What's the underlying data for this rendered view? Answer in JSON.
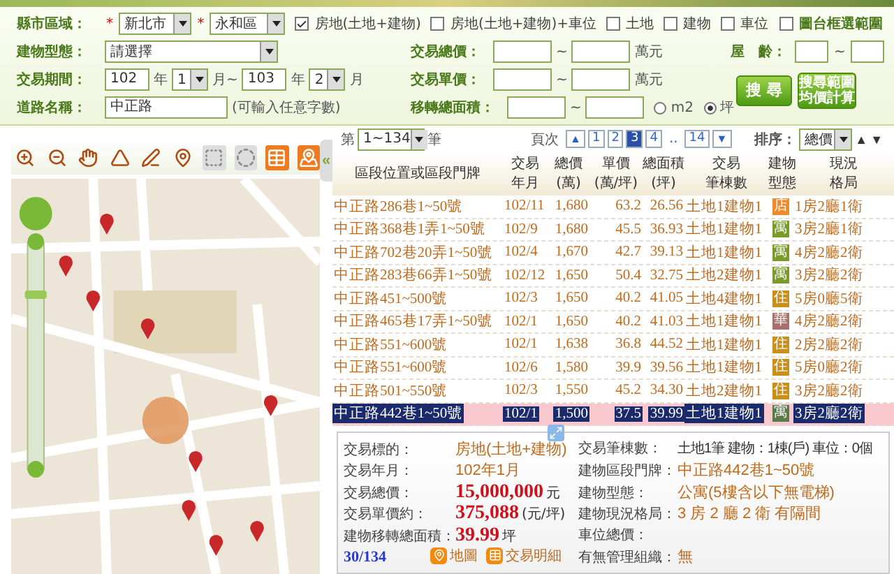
{
  "filters": {
    "region": {
      "label": "縣市區域：",
      "required_mark": "*",
      "city": "新北市",
      "district": "永和區"
    },
    "property_types": [
      {
        "label": "房地(土地+建物)",
        "checked": true
      },
      {
        "label": "房地(土地+建物)+車位",
        "checked": false
      },
      {
        "label": "土地",
        "checked": false
      },
      {
        "label": "建物",
        "checked": false
      },
      {
        "label": "車位",
        "checked": false
      }
    ],
    "map_select": {
      "label": "圖台框選範圍",
      "checked": false
    },
    "building_type": {
      "label": "建物型態：",
      "value": "請選擇"
    },
    "total_price": {
      "label": "交易總價：",
      "separator": "~",
      "unit": "萬元"
    },
    "age": {
      "label": "屋　齡：",
      "separator": "~"
    },
    "period": {
      "label": "交易期間：",
      "from_year": "102",
      "year_unit": "年",
      "from_month": "1",
      "month_unit": "月~",
      "to_year": "103",
      "to_year_unit": "年",
      "to_month": "2",
      "to_month_unit": "月"
    },
    "unit_price": {
      "label": "交易單價：",
      "separator": "~",
      "unit": "萬元"
    },
    "road": {
      "label": "道路名稱：",
      "value": "中正路",
      "hint": "(可輸入任意字數)"
    },
    "area": {
      "label": "移轉總面積：",
      "separator": "~",
      "units": [
        {
          "label": "m2",
          "selected": false
        },
        {
          "label": "坪",
          "selected": true
        }
      ]
    },
    "search_button": "搜 尋",
    "average_button": [
      "搜尋範圍",
      "均價計算"
    ]
  },
  "map_panel": {
    "collapse": "«"
  },
  "results": {
    "range_prefix": "第",
    "range": "1~134",
    "range_suffix": "筆",
    "pager": {
      "label": "頁次",
      "prev": "▲",
      "next": "▼",
      "pages": [
        {
          "label": "1",
          "kind": "page",
          "selected": false
        },
        {
          "label": "2",
          "kind": "page",
          "selected": false
        },
        {
          "label": "3",
          "kind": "page",
          "selected": true
        },
        {
          "label": "4",
          "kind": "page",
          "selected": false
        }
      ],
      "ellipsis": "..",
      "last_page": {
        "label": "14",
        "selected": false
      }
    },
    "sort": {
      "label": "排序：",
      "value": "總價",
      "asc": "▲",
      "desc": "▼"
    }
  },
  "table": {
    "columns": [
      [
        "區段位置或區段門牌"
      ],
      [
        "交易",
        "年月"
      ],
      [
        "總價",
        "(萬)"
      ],
      [
        "單價",
        "(萬/坪)"
      ],
      [
        "總面積",
        "(坪)"
      ],
      [
        "交易",
        "筆棟數"
      ],
      [
        "建物",
        "型態"
      ],
      [
        "現況",
        "格局"
      ]
    ],
    "rows": [
      {
        "address": "中正路286巷1~50號",
        "date": "102/11",
        "total": "1,680",
        "unit": "63.2",
        "area": "26.56",
        "parcels": "土地1建物1",
        "type": {
          "label": "店",
          "color": "#ef8a2a"
        },
        "layout": "1房2廳1衛",
        "selected": false
      },
      {
        "address": "中正路368巷1弄1~50號",
        "date": "102/9",
        "total": "1,680",
        "unit": "45.5",
        "area": "36.93",
        "parcels": "土地1建物1",
        "type": {
          "label": "寓",
          "color": "#7a9a2a"
        },
        "layout": "3房2廳1衛",
        "selected": false
      },
      {
        "address": "中正路702巷20弄1~50號",
        "date": "102/4",
        "total": "1,670",
        "unit": "42.7",
        "area": "39.13",
        "parcels": "土地1建物1",
        "type": {
          "label": "寓",
          "color": "#7a9a2a"
        },
        "layout": "4房2廳2衛",
        "selected": false
      },
      {
        "address": "中正路283巷66弄1~50號",
        "date": "102/12",
        "total": "1,650",
        "unit": "50.4",
        "area": "32.75",
        "parcels": "土地2建物1",
        "type": {
          "label": "寓",
          "color": "#7a9a2a"
        },
        "layout": "3房2廳2衛",
        "selected": false
      },
      {
        "address": "中正路451~500號",
        "date": "102/3",
        "total": "1,650",
        "unit": "40.2",
        "area": "41.05",
        "parcels": "土地4建物1",
        "type": {
          "label": "住",
          "color": "#c8901a"
        },
        "layout": "5房0廳5衛",
        "selected": false
      },
      {
        "address": "中正路465巷17弄1~50號",
        "date": "102/1",
        "total": "1,650",
        "unit": "40.2",
        "area": "41.03",
        "parcels": "土地1建物1",
        "type": {
          "label": "華",
          "color": "#a8706a"
        },
        "layout": "4房2廳2衛",
        "selected": false
      },
      {
        "address": "中正路551~600號",
        "date": "102/1",
        "total": "1,638",
        "unit": "36.8",
        "area": "44.52",
        "parcels": "土地1建物1",
        "type": {
          "label": "住",
          "color": "#c8901a"
        },
        "layout": "2房2廳2衛",
        "selected": false
      },
      {
        "address": "中正路551~600號",
        "date": "102/6",
        "total": "1,580",
        "unit": "39.9",
        "area": "39.56",
        "parcels": "土地1建物1",
        "type": {
          "label": "住",
          "color": "#c8901a"
        },
        "layout": "5房0廳2衛",
        "selected": false
      },
      {
        "address": "中正路501~550號",
        "date": "102/3",
        "total": "1,550",
        "unit": "45.2",
        "area": "34.30",
        "parcels": "土地2建物1",
        "type": {
          "label": "住",
          "color": "#c8901a"
        },
        "layout": "3房2廳2衛",
        "selected": false
      },
      {
        "address": "中正路442巷1~50號",
        "date": "102/1",
        "total": "1,500",
        "unit": "37.5",
        "area": "39.99",
        "parcels": "土地1建物1",
        "type": {
          "label": "寓",
          "color": "#5a7a4a"
        },
        "layout": "3房2廳2衛",
        "selected": true
      }
    ]
  },
  "detail": {
    "left": [
      {
        "label": "交易標的：",
        "value": "房地(土地+建物)",
        "kind": "text"
      },
      {
        "label": "交易年月：",
        "value": "102年1月",
        "kind": "text"
      },
      {
        "label": "交易總價：",
        "value": "15,000,000",
        "unit": "元",
        "kind": "amount"
      },
      {
        "label": "交易單價約：",
        "value": "375,088",
        "unit": "(元/坪)",
        "kind": "amount"
      },
      {
        "label": "建物移轉總面積：",
        "value": "39.99",
        "unit": "坪",
        "kind": "amount"
      }
    ],
    "record_index": "30/134",
    "links": [
      {
        "label": "地圖",
        "kind": "map"
      },
      {
        "label": "交易明細",
        "kind": "detail"
      }
    ],
    "right": [
      {
        "label": "交易筆棟數：",
        "value": "土地1筆 建物：1棟(戶) 車位：0個",
        "kind": "plain"
      },
      {
        "label": "建物區段門牌：",
        "value": "中正路442巷1~50號",
        "kind": "text"
      },
      {
        "label": "建物型態：",
        "value": "公寓(5樓含以下無電梯)",
        "kind": "text"
      },
      {
        "label": "建物現況格局：",
        "value": "3 房 2 廳 2 衛 有隔間",
        "kind": "text"
      },
      {
        "label": "車位總價："
      },
      {
        "label": "有無管理組織：",
        "value": "無",
        "kind": "text"
      }
    ]
  }
}
